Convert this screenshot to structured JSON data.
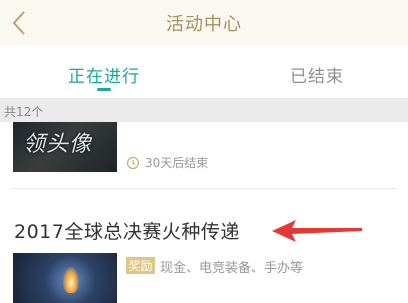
{
  "header": {
    "title": "活动中心",
    "back_icon": "chevron-left-icon"
  },
  "tabs": [
    {
      "label": "正在进行",
      "active": true
    },
    {
      "label": "已结束",
      "active": false
    }
  ],
  "count_label": "共12个",
  "activities": [
    {
      "thumbnail_text": "领头像",
      "time_icon": "clock-icon",
      "time_text": "30天后结束"
    },
    {
      "title": "2017全球总决赛火种传递",
      "badge": "奖励",
      "rewards": "现金、电竞装备、手办等"
    }
  ],
  "colors": {
    "accent": "#16a89a",
    "header_text": "#a5915e",
    "badge_bg": "#e0c684",
    "arrow": "#e53935"
  }
}
